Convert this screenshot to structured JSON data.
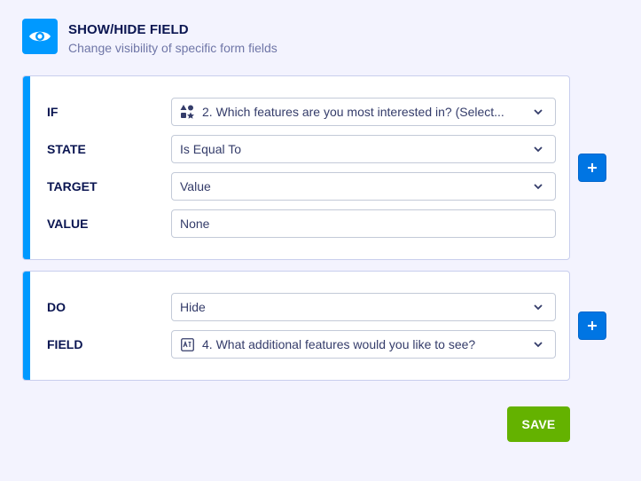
{
  "header": {
    "icon": "eye-icon",
    "title": "SHOW/HIDE FIELD",
    "subtitle": "Change visibility of specific form fields"
  },
  "condition": {
    "rows": [
      {
        "label": "IF",
        "value": "2. Which features are you most interested in? (Select...",
        "icon": "shapes-icon",
        "dropdown": true
      },
      {
        "label": "STATE",
        "value": "Is Equal To",
        "dropdown": true
      },
      {
        "label": "TARGET",
        "value": "Value",
        "dropdown": true
      },
      {
        "label": "VALUE",
        "value": "None",
        "dropdown": false
      }
    ],
    "add_button": "plus-icon"
  },
  "action": {
    "rows": [
      {
        "label": "DO",
        "value": "Hide",
        "dropdown": true
      },
      {
        "label": "FIELD",
        "value": "4. What additional features would you like to see?",
        "icon": "text-field-icon",
        "dropdown": true
      }
    ],
    "add_button": "plus-icon"
  },
  "footer": {
    "save_label": "SAVE"
  },
  "colors": {
    "accent": "#0099ff",
    "add_button": "#0075e3",
    "save": "#64b200",
    "background": "#f3f3fe"
  }
}
